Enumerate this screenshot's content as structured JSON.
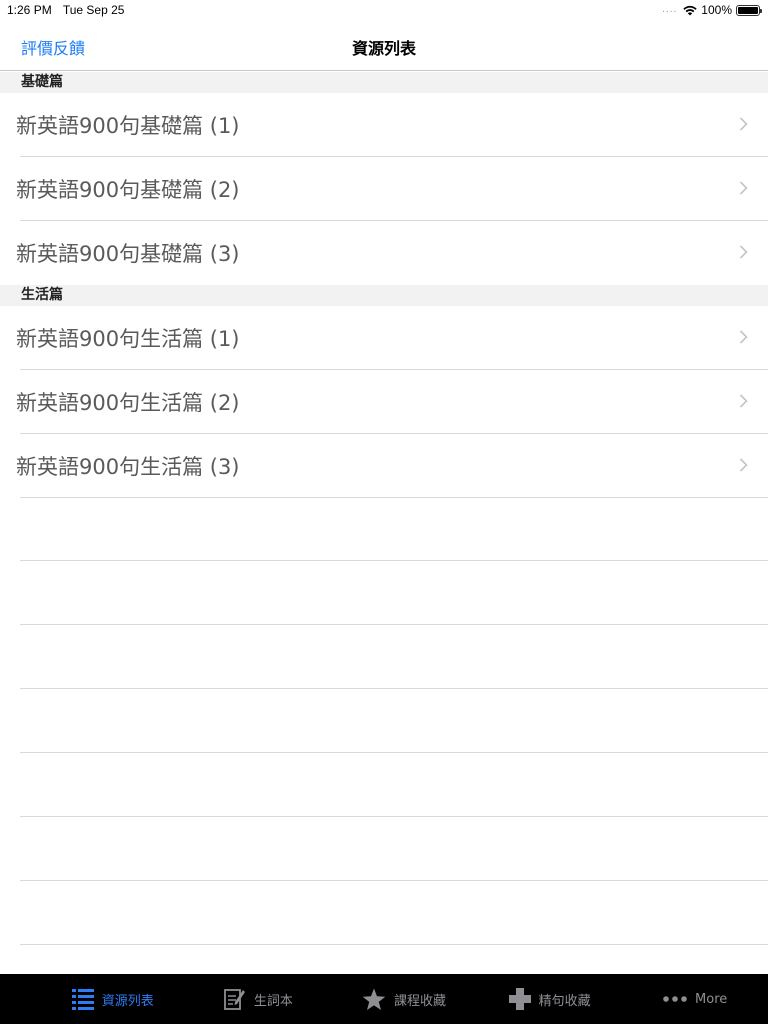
{
  "status_bar": {
    "time": "1:26 PM",
    "date": "Tue Sep 25",
    "signal": "....",
    "battery": "100%"
  },
  "nav": {
    "left_button": "評價反饋",
    "title": "資源列表"
  },
  "sections": [
    {
      "header": "基礎篇",
      "items": [
        "新英語900句基礎篇 (1)",
        "新英語900句基礎篇 (2)",
        "新英語900句基礎篇 (3)"
      ]
    },
    {
      "header": "生活篇",
      "items": [
        "新英語900句生活篇 (1)",
        "新英語900句生活篇 (2)",
        "新英語900句生活篇 (3)"
      ]
    }
  ],
  "tabs": [
    {
      "label": "資源列表",
      "icon": "list-icon",
      "active": true
    },
    {
      "label": "生詞本",
      "icon": "notebook-edit-icon",
      "active": false
    },
    {
      "label": "課程收藏",
      "icon": "star-icon",
      "active": false
    },
    {
      "label": "精句收藏",
      "icon": "plus-icon",
      "active": false
    },
    {
      "label": "More",
      "icon": "more-dots-icon",
      "active": false
    }
  ],
  "colors": {
    "accent": "#1a7cf5",
    "tab_active": "#2d7df6",
    "tab_inactive": "#8e8e93",
    "tab_bar_bg": "#000000"
  }
}
